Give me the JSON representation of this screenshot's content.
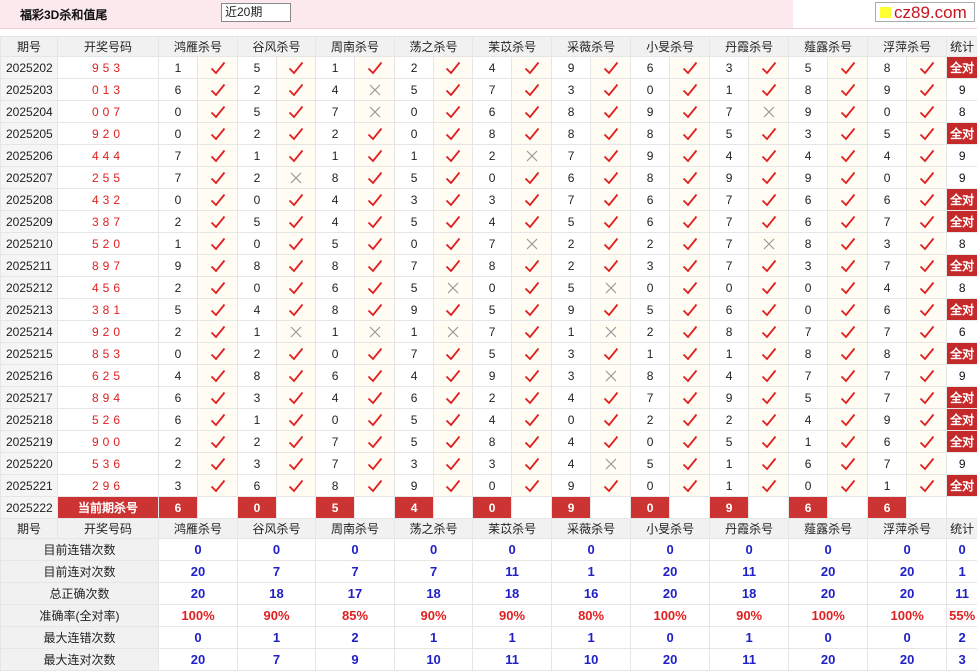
{
  "header": {
    "title": "福彩3D杀和值尾",
    "period_select": "近20期",
    "logo_text": "cz89.com"
  },
  "columns": {
    "issue": "期号",
    "number": "开奖号码",
    "experts": [
      "鸿雁杀号",
      "谷风杀号",
      "周南杀号",
      "荡之杀号",
      "苿苡杀号",
      "采薇杀号",
      "小旻杀号",
      "丹霞杀号",
      "薤露杀号",
      "浮萍杀号"
    ],
    "stat": "统计"
  },
  "rows": [
    {
      "issue": "2025202",
      "nums": "953",
      "kills": [
        1,
        5,
        1,
        2,
        4,
        9,
        6,
        3,
        5,
        8
      ],
      "hits": [
        1,
        1,
        1,
        1,
        1,
        1,
        1,
        1,
        1,
        1
      ],
      "count": "全对"
    },
    {
      "issue": "2025203",
      "nums": "013",
      "kills": [
        6,
        2,
        4,
        5,
        7,
        3,
        0,
        1,
        8,
        9
      ],
      "hits": [
        1,
        1,
        0,
        1,
        1,
        1,
        1,
        1,
        1,
        1
      ],
      "count": "9"
    },
    {
      "issue": "2025204",
      "nums": "007",
      "kills": [
        0,
        5,
        7,
        0,
        6,
        8,
        9,
        7,
        9,
        0
      ],
      "hits": [
        1,
        1,
        0,
        1,
        1,
        1,
        1,
        0,
        1,
        1
      ],
      "count": "8"
    },
    {
      "issue": "2025205",
      "nums": "920",
      "kills": [
        0,
        2,
        2,
        0,
        8,
        8,
        8,
        5,
        3,
        5
      ],
      "hits": [
        1,
        1,
        1,
        1,
        1,
        1,
        1,
        1,
        1,
        1
      ],
      "count": "全对"
    },
    {
      "issue": "2025206",
      "nums": "444",
      "kills": [
        7,
        1,
        1,
        1,
        2,
        7,
        9,
        4,
        4,
        4
      ],
      "hits": [
        1,
        1,
        1,
        1,
        0,
        1,
        1,
        1,
        1,
        1
      ],
      "count": "9"
    },
    {
      "issue": "2025207",
      "nums": "255",
      "kills": [
        7,
        2,
        8,
        5,
        0,
        6,
        8,
        9,
        9,
        0
      ],
      "hits": [
        1,
        0,
        1,
        1,
        1,
        1,
        1,
        1,
        1,
        1
      ],
      "count": "9"
    },
    {
      "issue": "2025208",
      "nums": "432",
      "kills": [
        0,
        0,
        4,
        3,
        3,
        7,
        6,
        7,
        6,
        6
      ],
      "hits": [
        1,
        1,
        1,
        1,
        1,
        1,
        1,
        1,
        1,
        1
      ],
      "count": "全对"
    },
    {
      "issue": "2025209",
      "nums": "387",
      "kills": [
        2,
        5,
        4,
        5,
        4,
        5,
        6,
        7,
        6,
        7
      ],
      "hits": [
        1,
        1,
        1,
        1,
        1,
        1,
        1,
        1,
        1,
        1
      ],
      "count": "全对"
    },
    {
      "issue": "2025210",
      "nums": "520",
      "kills": [
        1,
        0,
        5,
        0,
        7,
        2,
        2,
        7,
        8,
        3
      ],
      "hits": [
        1,
        1,
        1,
        1,
        0,
        1,
        1,
        0,
        1,
        1
      ],
      "count": "8"
    },
    {
      "issue": "2025211",
      "nums": "897",
      "kills": [
        9,
        8,
        8,
        7,
        8,
        2,
        3,
        7,
        3,
        7
      ],
      "hits": [
        1,
        1,
        1,
        1,
        1,
        1,
        1,
        1,
        1,
        1
      ],
      "count": "全对"
    },
    {
      "issue": "2025212",
      "nums": "456",
      "kills": [
        2,
        0,
        6,
        5,
        0,
        5,
        0,
        0,
        0,
        4
      ],
      "hits": [
        1,
        1,
        1,
        0,
        1,
        0,
        1,
        1,
        1,
        1
      ],
      "count": "8"
    },
    {
      "issue": "2025213",
      "nums": "381",
      "kills": [
        5,
        4,
        8,
        9,
        5,
        9,
        5,
        6,
        0,
        6
      ],
      "hits": [
        1,
        1,
        1,
        1,
        1,
        1,
        1,
        1,
        1,
        1
      ],
      "count": "全对"
    },
    {
      "issue": "2025214",
      "nums": "920",
      "kills": [
        2,
        1,
        1,
        1,
        7,
        1,
        2,
        8,
        7,
        7
      ],
      "hits": [
        1,
        0,
        0,
        0,
        1,
        0,
        1,
        1,
        1,
        1
      ],
      "count": "6"
    },
    {
      "issue": "2025215",
      "nums": "853",
      "kills": [
        0,
        2,
        0,
        7,
        5,
        3,
        1,
        1,
        8,
        8
      ],
      "hits": [
        1,
        1,
        1,
        1,
        1,
        1,
        1,
        1,
        1,
        1
      ],
      "count": "全对"
    },
    {
      "issue": "2025216",
      "nums": "625",
      "kills": [
        4,
        8,
        6,
        4,
        9,
        3,
        8,
        4,
        7,
        7
      ],
      "hits": [
        1,
        1,
        1,
        1,
        1,
        0,
        1,
        1,
        1,
        1
      ],
      "count": "9"
    },
    {
      "issue": "2025217",
      "nums": "894",
      "kills": [
        6,
        3,
        4,
        6,
        2,
        4,
        7,
        9,
        5,
        7
      ],
      "hits": [
        1,
        1,
        1,
        1,
        1,
        1,
        1,
        1,
        1,
        1
      ],
      "count": "全对"
    },
    {
      "issue": "2025218",
      "nums": "526",
      "kills": [
        6,
        1,
        0,
        5,
        4,
        0,
        2,
        2,
        4,
        9
      ],
      "hits": [
        1,
        1,
        1,
        1,
        1,
        1,
        1,
        1,
        1,
        1
      ],
      "count": "全对"
    },
    {
      "issue": "2025219",
      "nums": "900",
      "kills": [
        2,
        2,
        7,
        5,
        8,
        4,
        0,
        5,
        1,
        6
      ],
      "hits": [
        1,
        1,
        1,
        1,
        1,
        1,
        1,
        1,
        1,
        1
      ],
      "count": "全对"
    },
    {
      "issue": "2025220",
      "nums": "536",
      "kills": [
        2,
        3,
        7,
        3,
        3,
        4,
        5,
        1,
        6,
        7
      ],
      "hits": [
        1,
        1,
        1,
        1,
        1,
        0,
        1,
        1,
        1,
        1
      ],
      "count": "9"
    },
    {
      "issue": "2025221",
      "nums": "296",
      "kills": [
        3,
        6,
        8,
        9,
        0,
        9,
        0,
        1,
        0,
        1
      ],
      "hits": [
        1,
        1,
        1,
        1,
        1,
        1,
        1,
        1,
        1,
        1
      ],
      "count": "全对"
    }
  ],
  "current": {
    "issue": "2025222",
    "label": "当前期杀号",
    "kills": [
      "6",
      "0",
      "5",
      "4",
      "0",
      "9",
      "0",
      "9",
      "6",
      "6"
    ]
  },
  "stats": [
    {
      "label": "目前连错次数",
      "values": [
        "0",
        "0",
        "0",
        "0",
        "0",
        "0",
        "0",
        "0",
        "0",
        "0",
        "0"
      ]
    },
    {
      "label": "目前连对次数",
      "values": [
        "20",
        "7",
        "7",
        "7",
        "11",
        "1",
        "20",
        "11",
        "20",
        "20",
        "1"
      ]
    },
    {
      "label": "总正确次数",
      "values": [
        "20",
        "18",
        "17",
        "18",
        "18",
        "16",
        "20",
        "18",
        "20",
        "20",
        "11"
      ]
    },
    {
      "label": "准确率(全对率)",
      "values": [
        "100%",
        "90%",
        "85%",
        "90%",
        "90%",
        "80%",
        "100%",
        "90%",
        "100%",
        "100%",
        "55%"
      ],
      "rate": true
    },
    {
      "label": "最大连错次数",
      "values": [
        "0",
        "1",
        "2",
        "1",
        "1",
        "1",
        "0",
        "1",
        "0",
        "0",
        "2"
      ]
    },
    {
      "label": "最大连对次数",
      "values": [
        "20",
        "7",
        "9",
        "10",
        "11",
        "10",
        "20",
        "11",
        "20",
        "20",
        "3"
      ]
    }
  ],
  "colors": {
    "accent": "#c52a2a",
    "hit": "#e02020",
    "miss": "#999999",
    "stat": "#2020c8"
  }
}
